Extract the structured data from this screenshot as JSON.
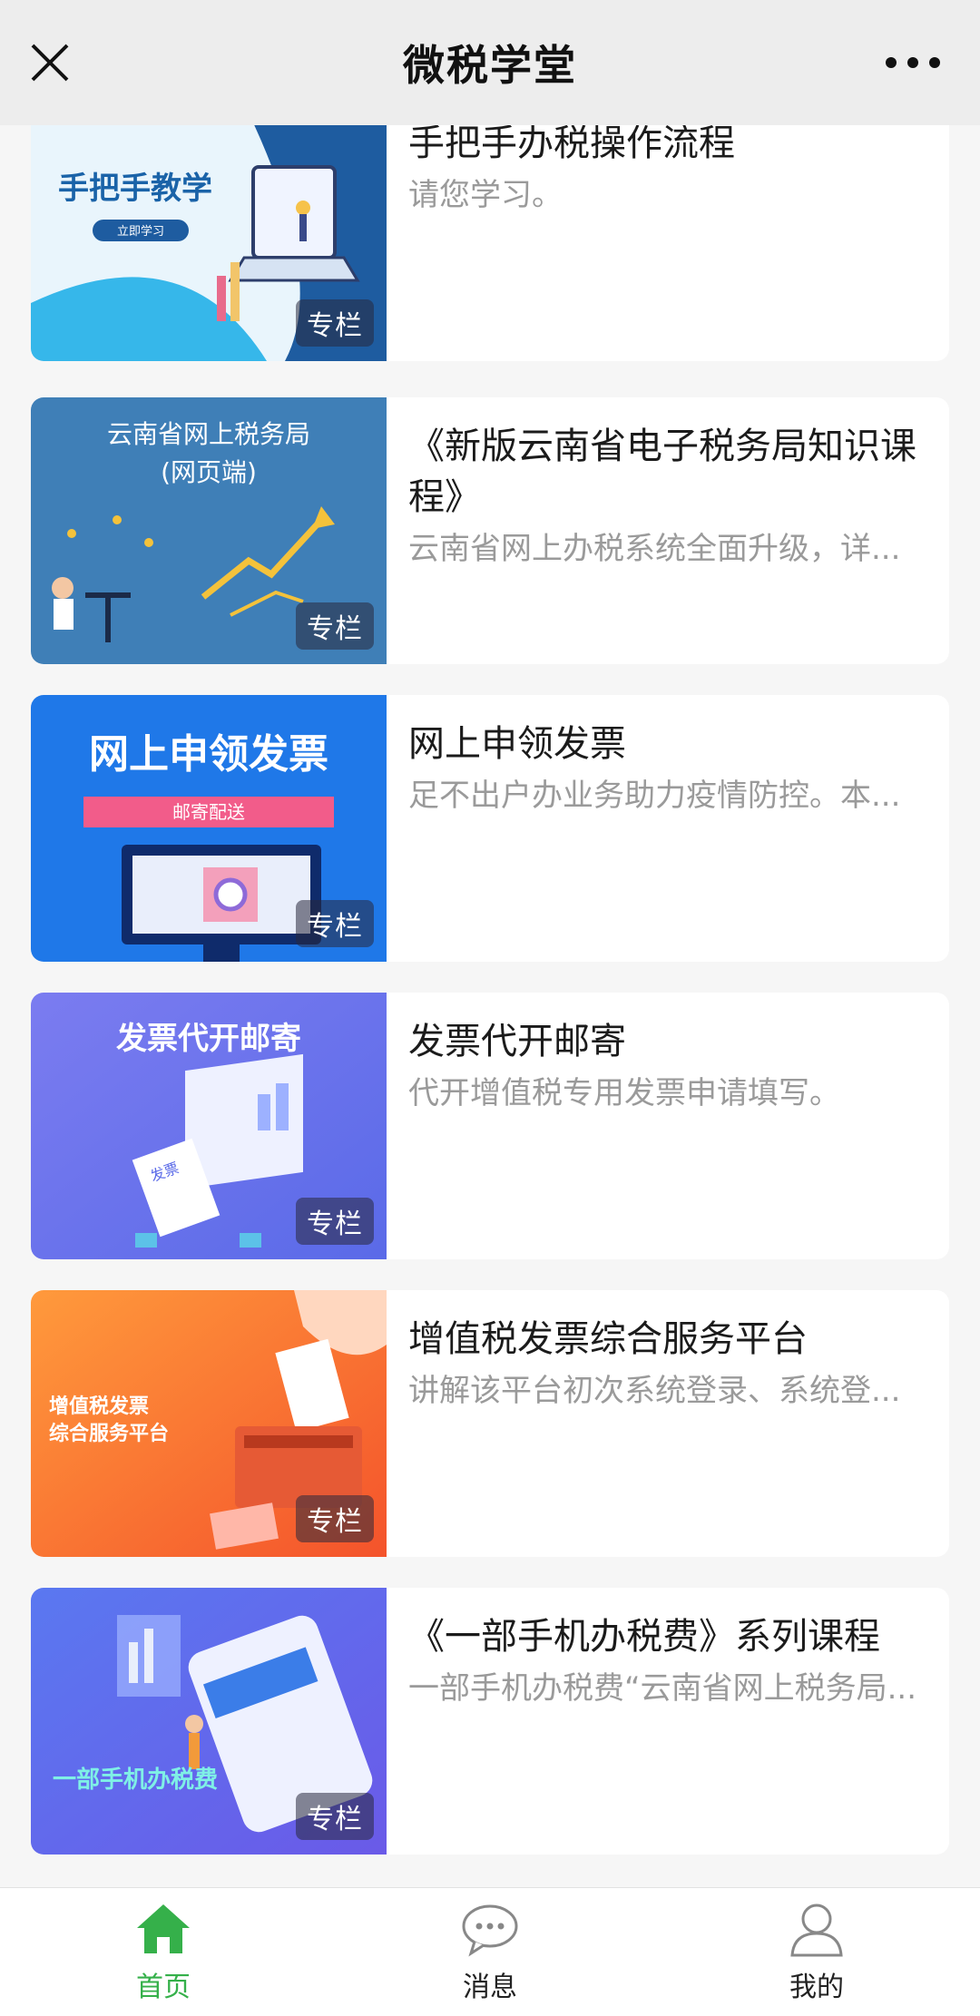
{
  "header": {
    "title": "微税学堂",
    "close_icon": "close-icon",
    "more_icon": "more-dots-icon"
  },
  "cards": [
    {
      "title": "手把手办税操作流程",
      "desc": "请您学习。",
      "badge": "专栏",
      "thumb_text": "手把手教学",
      "thumb_button": "立即学习"
    },
    {
      "title": "《新版云南省电子税务局知识课程》",
      "desc": "云南省网上办税系统全面升级，详...",
      "badge": "专栏",
      "thumb_text": "云南省网上税务局",
      "thumb_sub": "(网页端)"
    },
    {
      "title": "网上申领发票",
      "desc": "足不出户办业务助力疫情防控。本...",
      "badge": "专栏",
      "thumb_text": "网上申领发票",
      "thumb_sub": "邮寄配送"
    },
    {
      "title": "发票代开邮寄",
      "desc": "代开增值税专用发票申请填写。",
      "badge": "专栏",
      "thumb_text": "发票代开邮寄",
      "thumb_sub": "发票"
    },
    {
      "title": "增值税发票综合服务平台",
      "desc": "讲解该平台初次系统登录、系统登...",
      "badge": "专栏",
      "thumb_text": "增值税发票",
      "thumb_sub": "综合服务平台"
    },
    {
      "title": "《一部手机办税费》系列课程",
      "desc": "一部手机办税费“云南省网上税务局...",
      "badge": "专栏",
      "thumb_text": "一部手机办税费"
    }
  ],
  "tabs": [
    {
      "label": "首页",
      "icon": "home-icon",
      "active": true
    },
    {
      "label": "消息",
      "icon": "chat-bubble-icon",
      "active": false
    },
    {
      "label": "我的",
      "icon": "user-icon",
      "active": false
    }
  ],
  "colors": {
    "active": "#35b04a",
    "header_bg": "#ededed"
  }
}
